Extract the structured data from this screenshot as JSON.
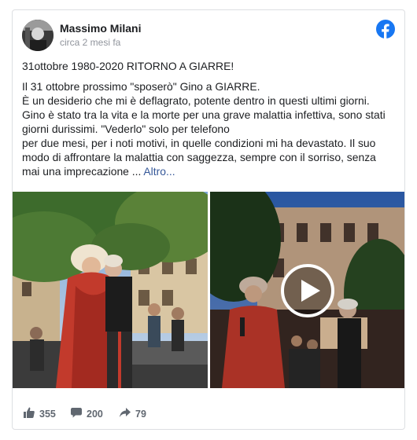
{
  "post": {
    "author": "Massimo Milani",
    "timestamp": "circa 2 mesi fa",
    "title": "31ottobre 1980-2020 RITORNO A GIARRE!",
    "lines": [
      "Il 31 ottobre prossimo \"sposerò\" Gino a GIARRE.",
      "È un desiderio che mi è deflagrato, potente dentro in questi ultimi giorni.",
      "Gino è stato tra la vita e la morte per una grave malattia infettiva, sono stati",
      "giorni durissimi. \"Vederlo\" solo per telefono",
      "per due mesi, per i noti motivi, in quelle condizioni mi ha devastato. Il suo",
      "modo di affrontare la malattia con saggezza, sempre con il sorriso, senza",
      "mai una imprecazione ..."
    ],
    "more_label": "Altro...",
    "icons": {
      "platform": "facebook-icon",
      "play": "play-icon",
      "like": "thumbs-up-icon",
      "comment": "comment-icon",
      "share": "share-icon"
    },
    "colors": {
      "facebook_blue": "#1877f2",
      "link": "#365899",
      "muted": "#90949c"
    }
  },
  "stats": {
    "likes": "355",
    "comments": "200",
    "shares": "79"
  }
}
